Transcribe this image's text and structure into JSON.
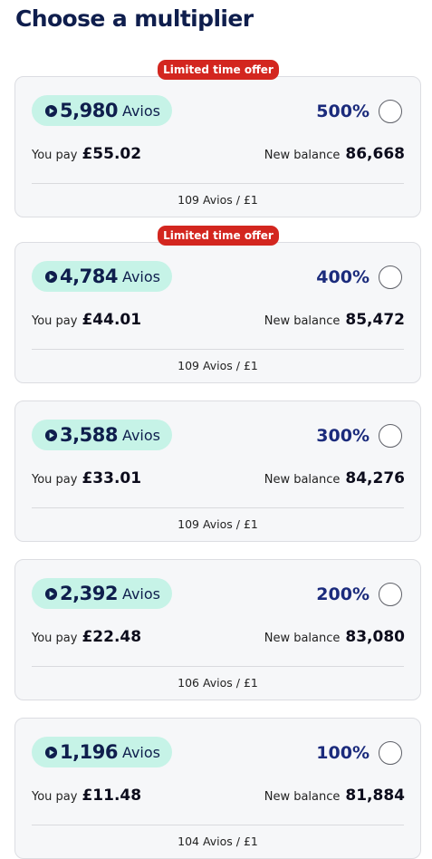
{
  "title": "Choose a multiplier",
  "icons": {
    "avios": "play-circle-icon",
    "select": "radio-button-icon"
  },
  "colors": {
    "title": "#0f1e4d",
    "badge": "#d3261f",
    "pill": "#c6f3e7",
    "multiplier": "#1b2b7c"
  },
  "labels": {
    "avios_unit": "Avios",
    "you_pay": "You pay",
    "new_balance": "New balance"
  },
  "options": [
    {
      "badge": "Limited time offer",
      "avios": "5,980",
      "multiplier": "500%",
      "price": "£55.02",
      "balance": "86,668",
      "rate": "109 Avios / £1",
      "selected": false
    },
    {
      "badge": "Limited time offer",
      "avios": "4,784",
      "multiplier": "400%",
      "price": "£44.01",
      "balance": "85,472",
      "rate": "109 Avios / £1",
      "selected": false
    },
    {
      "badge": "",
      "avios": "3,588",
      "multiplier": "300%",
      "price": "£33.01",
      "balance": "84,276",
      "rate": "109 Avios / £1",
      "selected": false
    },
    {
      "badge": "",
      "avios": "2,392",
      "multiplier": "200%",
      "price": "£22.48",
      "balance": "83,080",
      "rate": "106 Avios / £1",
      "selected": false
    },
    {
      "badge": "",
      "avios": "1,196",
      "multiplier": "100%",
      "price": "£11.48",
      "balance": "81,884",
      "rate": "104 Avios / £1",
      "selected": false
    }
  ]
}
